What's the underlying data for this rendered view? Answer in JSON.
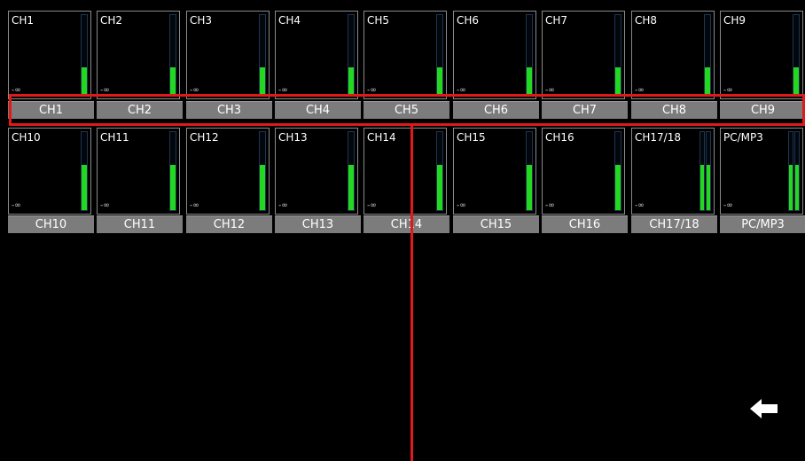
{
  "channels_row1": [
    {
      "id": "ch1",
      "name": "CH1",
      "button": "CH1",
      "level": 0.35,
      "stereo": false
    },
    {
      "id": "ch2",
      "name": "CH2",
      "button": "CH2",
      "level": 0.35,
      "stereo": false
    },
    {
      "id": "ch3",
      "name": "CH3",
      "button": "CH3",
      "level": 0.35,
      "stereo": false
    },
    {
      "id": "ch4",
      "name": "CH4",
      "button": "CH4",
      "level": 0.35,
      "stereo": false
    },
    {
      "id": "ch5",
      "name": "CH5",
      "button": "CH5",
      "level": 0.35,
      "stereo": false
    },
    {
      "id": "ch6",
      "name": "CH6",
      "button": "CH6",
      "level": 0.35,
      "stereo": false
    },
    {
      "id": "ch7",
      "name": "CH7",
      "button": "CH7",
      "level": 0.35,
      "stereo": false
    },
    {
      "id": "ch8",
      "name": "CH8",
      "button": "CH8",
      "level": 0.35,
      "stereo": false
    },
    {
      "id": "ch9",
      "name": "CH9",
      "button": "CH9",
      "level": 0.35,
      "stereo": false
    }
  ],
  "channels_row2": [
    {
      "id": "ch10",
      "name": "CH10",
      "button": "CH10",
      "level": 0.58,
      "stereo": false
    },
    {
      "id": "ch11",
      "name": "CH11",
      "button": "CH11",
      "level": 0.58,
      "stereo": false
    },
    {
      "id": "ch12",
      "name": "CH12",
      "button": "CH12",
      "level": 0.58,
      "stereo": false
    },
    {
      "id": "ch13",
      "name": "CH13",
      "button": "CH13",
      "level": 0.58,
      "stereo": false
    },
    {
      "id": "ch14",
      "name": "CH14",
      "button": "CH14",
      "level": 0.58,
      "stereo": false
    },
    {
      "id": "ch15",
      "name": "CH15",
      "button": "CH15",
      "level": 0.58,
      "stereo": false
    },
    {
      "id": "ch16",
      "name": "CH16",
      "button": "CH16",
      "level": 0.58,
      "stereo": false
    },
    {
      "id": "ch17-18",
      "name": "CH17/18",
      "button": "CH17/18",
      "level": 0.58,
      "stereo": true
    },
    {
      "id": "pc-mp3",
      "name": "PC/MP3",
      "button": "PC/MP3",
      "level": 0.58,
      "stereo": true
    }
  ],
  "meter_floor_label": "-∞",
  "colors": {
    "meter_fill": "#23d821",
    "highlight": "#e01919",
    "button_bg": "#7c7c7c"
  },
  "back_button_icon": "back-arrow-icon"
}
